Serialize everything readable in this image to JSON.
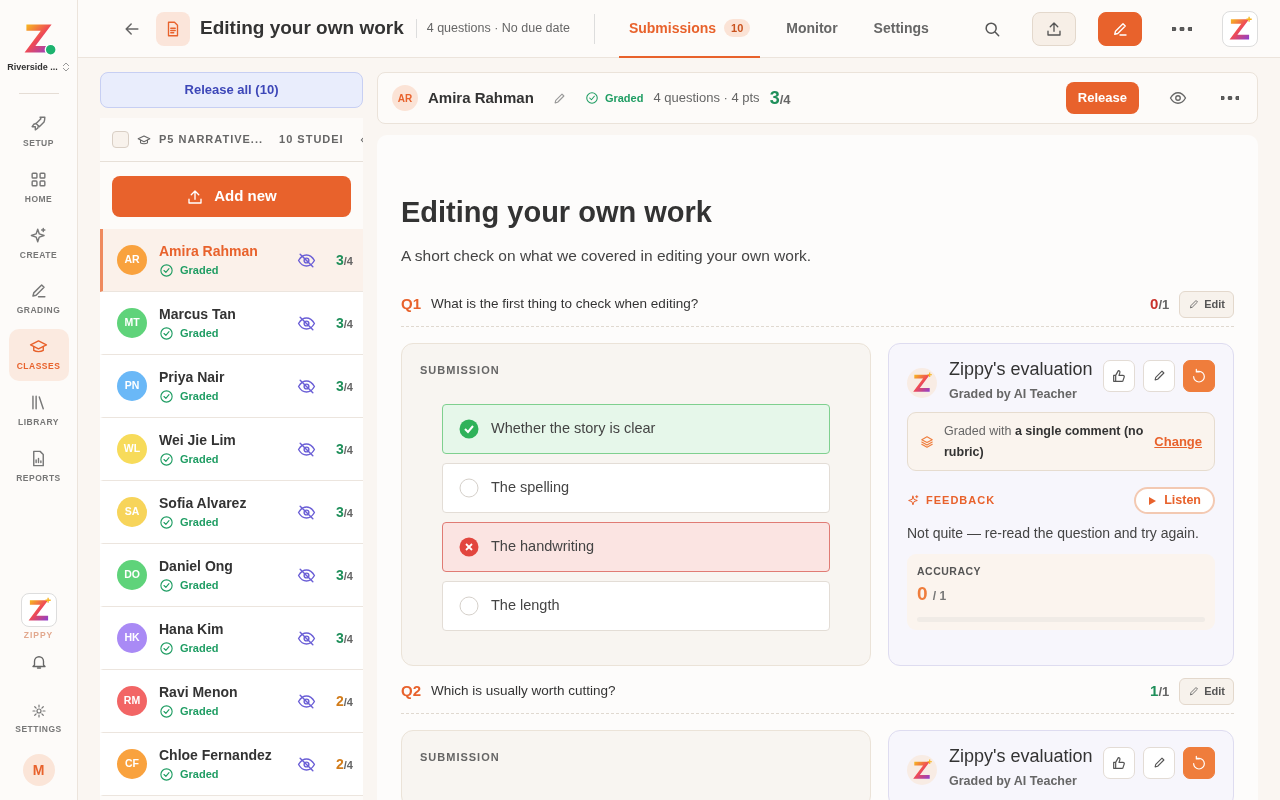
{
  "org": {
    "name": "Riverside ..."
  },
  "nav": [
    {
      "label": "SETUP",
      "selected": false
    },
    {
      "label": "HOME",
      "selected": false
    },
    {
      "label": "CREATE",
      "selected": false
    },
    {
      "label": "GRADING",
      "selected": false
    },
    {
      "label": "CLASSES",
      "selected": true
    },
    {
      "label": "LIBRARY",
      "selected": false
    },
    {
      "label": "REPORTS",
      "selected": false
    }
  ],
  "nav_bottom": {
    "assistant": "ZIPPY",
    "settings": "SETTINGS",
    "user_initial": "M"
  },
  "header": {
    "title": "Editing your own work",
    "meta": "4 questions · No due date",
    "tabs": [
      {
        "label": "Submissions",
        "count": "10",
        "selected": true
      },
      {
        "label": "Monitor",
        "selected": false
      },
      {
        "label": "Settings",
        "selected": false
      }
    ]
  },
  "release_all": "Release all (10)",
  "class_bar": {
    "name": "P5 NARRATIVE...",
    "count": "10 STUDEI",
    "checked": false
  },
  "add_new": "Add new",
  "students": [
    {
      "initials": "AR",
      "name": "Amira Rahman",
      "status": "Graded",
      "score": "3",
      "total": "/4",
      "color": "#f9a23e",
      "selected": true
    },
    {
      "initials": "MT",
      "name": "Marcus Tan",
      "status": "Graded",
      "score": "3",
      "total": "/4",
      "color": "#5fd37a",
      "selected": false
    },
    {
      "initials": "PN",
      "name": "Priya Nair",
      "status": "Graded",
      "score": "3",
      "total": "/4",
      "color": "#6ab8f7",
      "selected": false
    },
    {
      "initials": "WL",
      "name": "Wei Jie Lim",
      "status": "Graded",
      "score": "3",
      "total": "/4",
      "color": "#f7db5a",
      "selected": false
    },
    {
      "initials": "SA",
      "name": "Sofia Alvarez",
      "status": "Graded",
      "score": "3",
      "total": "/4",
      "color": "#f7d45a",
      "selected": false
    },
    {
      "initials": "DO",
      "name": "Daniel Ong",
      "status": "Graded",
      "score": "3",
      "total": "/4",
      "color": "#5fd37a",
      "selected": false
    },
    {
      "initials": "HK",
      "name": "Hana Kim",
      "status": "Graded",
      "score": "3",
      "total": "/4",
      "color": "#a98af5",
      "selected": false
    },
    {
      "initials": "RM",
      "name": "Ravi Menon",
      "status": "Graded",
      "score": "2",
      "total": "/4",
      "color": "#f26565",
      "selected": false
    },
    {
      "initials": "CF",
      "name": "Chloe Fernandez",
      "status": "Graded",
      "score": "2",
      "total": "/4",
      "color": "#f9a23e",
      "selected": false
    }
  ],
  "student_header": {
    "initials": "AR",
    "name": "Amira Rahman",
    "status": "Graded",
    "meta": "4 questions · 4 pts",
    "score": "3",
    "total": "/4",
    "release": "Release"
  },
  "assignment": {
    "title": "Editing your own work",
    "description": "A short check on what we covered in editing your own work."
  },
  "questions": [
    {
      "number": "Q1",
      "text": "What is the first thing to check when editing?",
      "score": "0",
      "total": "/1",
      "edit": "Edit",
      "submission_label": "SUBMISSION",
      "options": [
        {
          "text": "Whether the story is clear",
          "kind": "correct"
        },
        {
          "text": "The spelling",
          "kind": "plain"
        },
        {
          "text": "The handwriting",
          "kind": "incorrect"
        },
        {
          "text": "The length",
          "kind": "plain"
        }
      ],
      "evaluation": {
        "title": "Zippy's evaluation",
        "subtitle": "Graded by AI Teacher",
        "rubric": "Graded with **a single comment (no rubric)**",
        "change": "Change",
        "feedback_label": "FEEDBACK",
        "listen": "Listen",
        "feedback": "Not quite — re-read the question and try again.",
        "accuracy_label": "ACCURACY",
        "accuracy": "0",
        "accuracy_total": "/ 1",
        "level": 0
      }
    },
    {
      "number": "Q2",
      "text": "Which is usually worth cutting?",
      "score": "1",
      "total": "/1",
      "edit": "Edit",
      "submission_label": "SUBMISSION",
      "evaluation": {
        "title": "Zippy's evaluation",
        "subtitle": "Graded by AI Teacher"
      }
    }
  ]
}
